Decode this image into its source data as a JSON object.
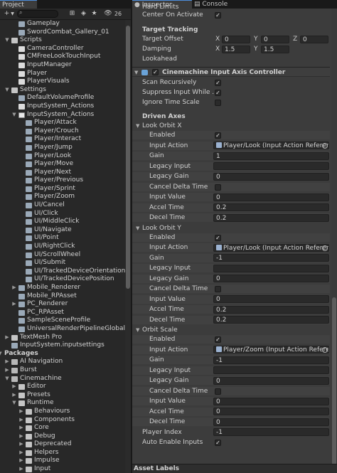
{
  "project": {
    "tab_label": "Project",
    "count_badge": "26",
    "toolbar_icons": [
      "plus-icon",
      "search-icon",
      "filter-icon",
      "label-icon",
      "star-icon",
      "eye-icon"
    ],
    "tree": [
      {
        "label": "Gameplay",
        "indent": 1,
        "icon": "asset"
      },
      {
        "label": "SwordCombat_Gallery_01",
        "indent": 1,
        "icon": "asset"
      },
      {
        "label": "Scripts",
        "indent": 0,
        "icon": "folder",
        "arrow": "down"
      },
      {
        "label": "CameraController",
        "indent": 1,
        "icon": "script"
      },
      {
        "label": "CMFreeLookTouchInput",
        "indent": 1,
        "icon": "script"
      },
      {
        "label": "InputManager",
        "indent": 1,
        "icon": "script"
      },
      {
        "label": "Player",
        "indent": 1,
        "icon": "script"
      },
      {
        "label": "PlayerVisuals",
        "indent": 1,
        "icon": "script"
      },
      {
        "label": "Settings",
        "indent": 0,
        "icon": "folder",
        "arrow": "down"
      },
      {
        "label": "DefaultVolumeProfile",
        "indent": 1,
        "icon": "asset"
      },
      {
        "label": "InputSystem_Actions",
        "indent": 1,
        "icon": "script"
      },
      {
        "label": "InputSystem_Actions",
        "indent": 1,
        "icon": "input",
        "arrow": "down"
      },
      {
        "label": "Player/Attack",
        "indent": 2,
        "icon": "asset"
      },
      {
        "label": "Player/Crouch",
        "indent": 2,
        "icon": "asset"
      },
      {
        "label": "Player/Interact",
        "indent": 2,
        "icon": "asset"
      },
      {
        "label": "Player/Jump",
        "indent": 2,
        "icon": "asset"
      },
      {
        "label": "Player/Look",
        "indent": 2,
        "icon": "asset"
      },
      {
        "label": "Player/Move",
        "indent": 2,
        "icon": "asset"
      },
      {
        "label": "Player/Next",
        "indent": 2,
        "icon": "asset"
      },
      {
        "label": "Player/Previous",
        "indent": 2,
        "icon": "asset"
      },
      {
        "label": "Player/Sprint",
        "indent": 2,
        "icon": "asset"
      },
      {
        "label": "Player/Zoom",
        "indent": 2,
        "icon": "asset"
      },
      {
        "label": "UI/Cancel",
        "indent": 2,
        "icon": "asset"
      },
      {
        "label": "UI/Click",
        "indent": 2,
        "icon": "asset"
      },
      {
        "label": "UI/MiddleClick",
        "indent": 2,
        "icon": "asset"
      },
      {
        "label": "UI/Navigate",
        "indent": 2,
        "icon": "asset"
      },
      {
        "label": "UI/Point",
        "indent": 2,
        "icon": "asset"
      },
      {
        "label": "UI/RightClick",
        "indent": 2,
        "icon": "asset"
      },
      {
        "label": "UI/ScrollWheel",
        "indent": 2,
        "icon": "asset"
      },
      {
        "label": "UI/Submit",
        "indent": 2,
        "icon": "asset"
      },
      {
        "label": "UI/TrackedDeviceOrientation",
        "indent": 2,
        "icon": "asset"
      },
      {
        "label": "UI/TrackedDevicePosition",
        "indent": 2,
        "icon": "asset"
      },
      {
        "label": "Mobile_Renderer",
        "indent": 1,
        "icon": "asset",
        "arrow": "right"
      },
      {
        "label": "Mobile_RPAsset",
        "indent": 1,
        "icon": "asset"
      },
      {
        "label": "PC_Renderer",
        "indent": 1,
        "icon": "asset",
        "arrow": "right"
      },
      {
        "label": "PC_RPAsset",
        "indent": 1,
        "icon": "asset"
      },
      {
        "label": "SampleSceneProfile",
        "indent": 1,
        "icon": "asset"
      },
      {
        "label": "UniversalRenderPipelineGlobalSe",
        "indent": 1,
        "icon": "asset"
      },
      {
        "label": "TextMesh Pro",
        "indent": 0,
        "icon": "folder",
        "arrow": "right"
      },
      {
        "label": "InputSystem.inputsettings",
        "indent": 0,
        "icon": "asset"
      },
      {
        "label": "Packages",
        "indent": -1,
        "icon": "",
        "arrow": "down",
        "bold": true
      },
      {
        "label": "AI Navigation",
        "indent": 0,
        "icon": "pkg",
        "arrow": "right"
      },
      {
        "label": "Burst",
        "indent": 0,
        "icon": "pkg",
        "arrow": "right"
      },
      {
        "label": "Cinemachine",
        "indent": 0,
        "icon": "pkg",
        "arrow": "down"
      },
      {
        "label": "Editor",
        "indent": 1,
        "icon": "folder",
        "arrow": "right"
      },
      {
        "label": "Presets",
        "indent": 1,
        "icon": "folder",
        "arrow": "right"
      },
      {
        "label": "Runtime",
        "indent": 1,
        "icon": "folder",
        "arrow": "down"
      },
      {
        "label": "Behaviours",
        "indent": 2,
        "icon": "folder",
        "arrow": "right"
      },
      {
        "label": "Components",
        "indent": 2,
        "icon": "folder",
        "arrow": "right"
      },
      {
        "label": "Core",
        "indent": 2,
        "icon": "folder",
        "arrow": "right"
      },
      {
        "label": "Debug",
        "indent": 2,
        "icon": "folder",
        "arrow": "right"
      },
      {
        "label": "Deprecated",
        "indent": 2,
        "icon": "folder",
        "arrow": "right"
      },
      {
        "label": "Helpers",
        "indent": 2,
        "icon": "folder",
        "arrow": "right"
      },
      {
        "label": "Impulse",
        "indent": 2,
        "icon": "folder",
        "arrow": "right"
      },
      {
        "label": "Input",
        "indent": 2,
        "icon": "folder",
        "arrow": "right"
      }
    ]
  },
  "inspector": {
    "tab_label": "Inspector",
    "console_tab_label": "Console",
    "top_rows": {
      "hard_limits": "Hard Limits",
      "center_on_activate": "Center On Activate",
      "center_on_activate_checked": true
    },
    "target_tracking": {
      "header": "Target Tracking",
      "target_offset_label": "Target Offset",
      "target_offset": {
        "x": "0",
        "y": "0",
        "z": "0"
      },
      "damping_label": "Damping",
      "damping": {
        "x": "1.5",
        "y": "1.5"
      },
      "lookahead_label": "Lookahead",
      "axis_labels": {
        "x": "X",
        "y": "Y",
        "z": "Z"
      }
    },
    "component": {
      "title": "Cinemachine Input Axis Controller",
      "enabled": true,
      "scan_recursively_label": "Scan Recursively",
      "scan_recursively": true,
      "suppress_input_label": "Suppress Input While ...",
      "suppress_input": true,
      "ignore_time_scale_label": "Ignore Time Scale",
      "ignore_time_scale": false
    },
    "driven_axes": {
      "header": "Driven Axes",
      "field_labels": {
        "enabled": "Enabled",
        "input_action": "Input Action",
        "gain": "Gain",
        "legacy_input": "Legacy Input",
        "legacy_gain": "Legacy Gain",
        "cancel_delta_time": "Cancel Delta Time",
        "input_value": "Input Value",
        "accel_time": "Accel Time",
        "decel_time": "Decel Time"
      },
      "axes": [
        {
          "name": "Look Orbit X",
          "enabled": true,
          "input_action": "Player/Look (Input Action Referen",
          "gain": "1",
          "legacy_input": "",
          "legacy_gain": "0",
          "cancel_delta_time": false,
          "input_value": "0",
          "accel_time": "0.2",
          "decel_time": "0.2"
        },
        {
          "name": "Look Orbit Y",
          "enabled": true,
          "input_action": "Player/Look (Input Action Referen",
          "gain": "-1",
          "legacy_input": "",
          "legacy_gain": "0",
          "cancel_delta_time": false,
          "input_value": "0",
          "accel_time": "0.2",
          "decel_time": "0.2"
        },
        {
          "name": "Orbit Scale",
          "enabled": true,
          "input_action": "Player/Zoom (Input Action Referen",
          "gain": "-1",
          "legacy_input": "",
          "legacy_gain": "0",
          "cancel_delta_time": false,
          "input_value": "0",
          "accel_time": "0",
          "decel_time": "0"
        }
      ]
    },
    "player_index_label": "Player Index",
    "player_index": "-1",
    "auto_enable_inputs_label": "Auto Enable Inputs",
    "auto_enable_inputs": true,
    "asset_labels": "Asset Labels"
  }
}
